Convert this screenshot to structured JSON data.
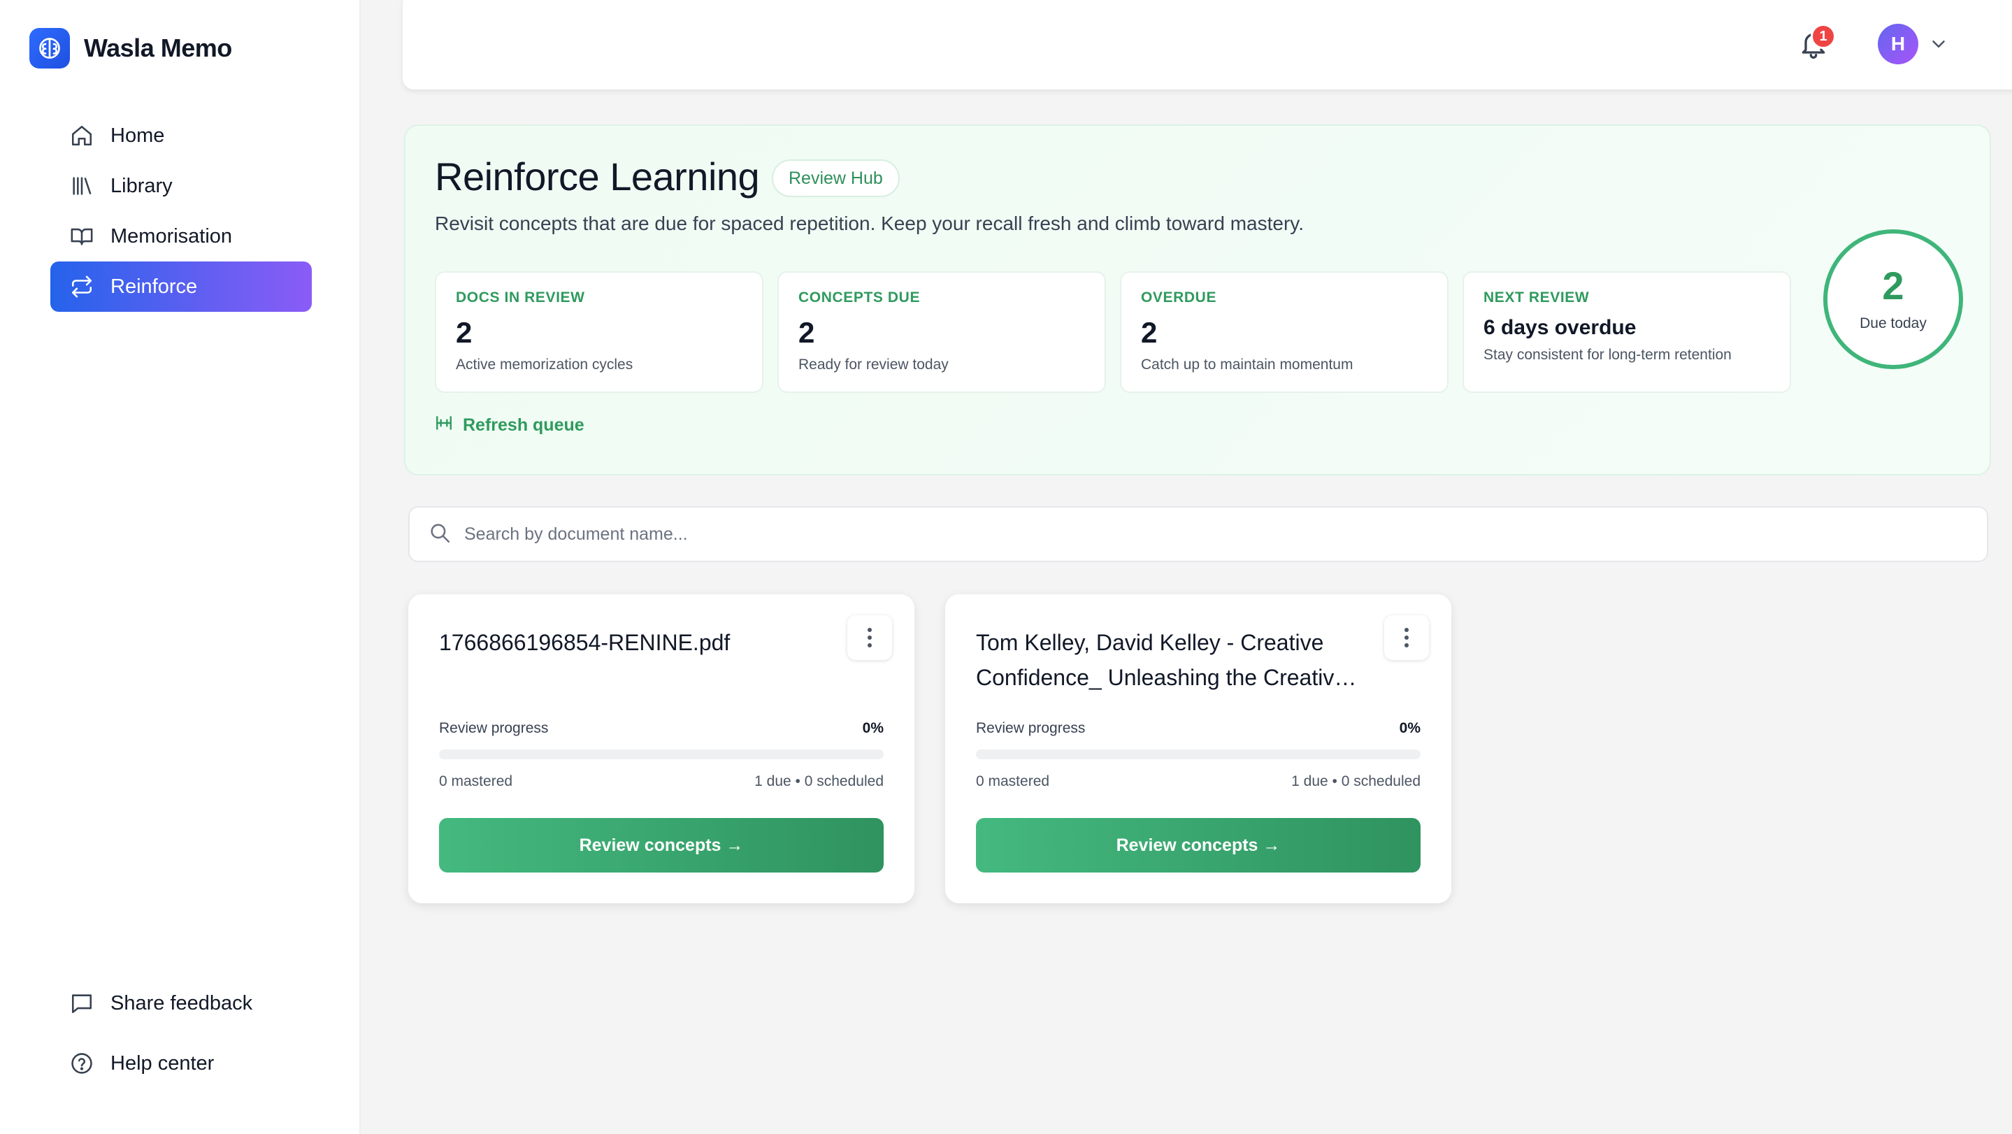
{
  "brand": {
    "name": "Wasla Memo",
    "logo_icon": "brain-icon",
    "logo_color": "#2563eb"
  },
  "nav": {
    "items": [
      {
        "label": "Home",
        "icon": "home-icon",
        "active": false
      },
      {
        "label": "Library",
        "icon": "library-icon",
        "active": false
      },
      {
        "label": "Memorisation",
        "icon": "book-open-icon",
        "active": false
      },
      {
        "label": "Reinforce",
        "icon": "repeat-icon",
        "active": true
      }
    ],
    "bottom": [
      {
        "label": "Share feedback",
        "icon": "message-square-icon"
      },
      {
        "label": "Help center",
        "icon": "help-circle-icon"
      }
    ]
  },
  "header": {
    "notification_count": "1",
    "avatar_initial": "H"
  },
  "hero": {
    "title": "Reinforce Learning",
    "badge": "Review Hub",
    "subtitle": "Revisit concepts that are due for spaced repetition. Keep your recall fresh and climb toward mastery.",
    "stats": [
      {
        "label": "Docs in review",
        "value": "2",
        "description": "Active memorization cycles"
      },
      {
        "label": "Concepts due",
        "value": "2",
        "description": "Ready for review today"
      },
      {
        "label": "Overdue",
        "value": "2",
        "description": "Catch up to maintain momentum"
      },
      {
        "label": "Next review",
        "value": "6 days overdue",
        "description": "Stay consistent for long-term retention"
      }
    ],
    "refresh_label": "Refresh queue",
    "ring": {
      "value": "2",
      "label": "Due today"
    }
  },
  "search": {
    "placeholder": "Search by document name...",
    "value": ""
  },
  "cards": [
    {
      "title": "1766866196854-RENINE.pdf",
      "progress_label": "Review progress",
      "progress_pct": "0%",
      "progress_value": 0,
      "mastered": "0 mastered",
      "due": "1 due • 0 scheduled",
      "button": "Review concepts →"
    },
    {
      "title": "Tom Kelley, David Kelley - Creative Confidence_ Unleashing the Creative Potential Within Us All",
      "progress_label": "Review progress",
      "progress_pct": "0%",
      "progress_value": 0,
      "mastered": "0 mastered",
      "due": "1 due • 0 scheduled",
      "button": "Review concepts →"
    }
  ],
  "colors": {
    "accent_green": "#2f9a5e",
    "nav_active_start": "#2563eb",
    "nav_active_end": "#8b5cf6",
    "badge_red": "#ef4444"
  }
}
